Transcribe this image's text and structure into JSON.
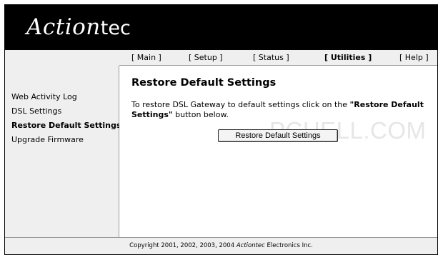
{
  "header": {
    "logo_main": "Action",
    "logo_tail": "tec"
  },
  "nav": {
    "items": [
      {
        "label": "[ Main ]"
      },
      {
        "label": "[ Setup ]"
      },
      {
        "label": "[ Status ]"
      },
      {
        "label": "[ Utilities ]"
      },
      {
        "label": "[ Help ]"
      }
    ]
  },
  "sidebar": {
    "items": [
      {
        "label": "Web Activity Log"
      },
      {
        "label": "DSL Settings"
      },
      {
        "label": "Restore Default Settings"
      },
      {
        "label": "Upgrade Firmware"
      }
    ]
  },
  "main": {
    "title": "Restore Default Settings",
    "desc_prefix": "To restore DSL Gateway to default settings click on the ",
    "desc_bold": "\"Restore Default Settings\"",
    "desc_suffix": " button below.",
    "button_label": "Restore Default Settings",
    "watermark": "PCHELL.COM"
  },
  "footer": {
    "prefix": "Copyright 2001, 2002, 2003, 2004 ",
    "brand": "Actiontec",
    "suffix": " Electronics Inc."
  }
}
